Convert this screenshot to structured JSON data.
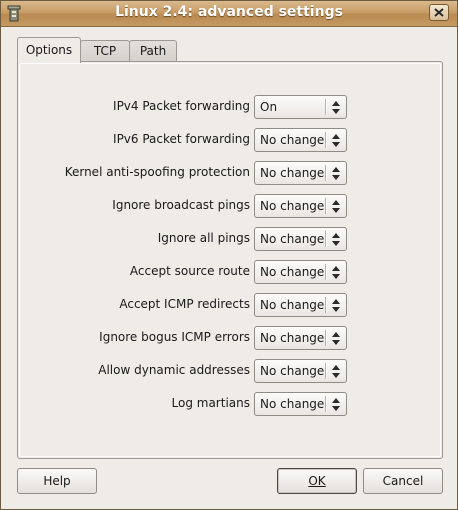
{
  "window": {
    "title": "Linux 2.4: advanced settings"
  },
  "tabs": [
    {
      "label": "Options",
      "active": true
    },
    {
      "label": "TCP",
      "active": false
    },
    {
      "label": "Path",
      "active": false
    }
  ],
  "settings": [
    {
      "label": "IPv4 Packet forwarding",
      "value": "On"
    },
    {
      "label": "IPv6 Packet forwarding",
      "value": "No change"
    },
    {
      "label": "Kernel anti-spoofing protection",
      "value": "No change"
    },
    {
      "label": "Ignore broadcast pings",
      "value": "No change"
    },
    {
      "label": "Ignore all pings",
      "value": "No change"
    },
    {
      "label": "Accept source route",
      "value": "No change"
    },
    {
      "label": "Accept ICMP redirects",
      "value": "No change"
    },
    {
      "label": "Ignore bogus ICMP errors",
      "value": "No change"
    },
    {
      "label": "Allow dynamic addresses",
      "value": "No change"
    },
    {
      "label": "Log martians",
      "value": "No change"
    }
  ],
  "buttons": {
    "help": "Help",
    "ok": "OK",
    "cancel": "Cancel"
  },
  "colors": {
    "titlebar": "#c89d66",
    "background": "#efebe7"
  }
}
